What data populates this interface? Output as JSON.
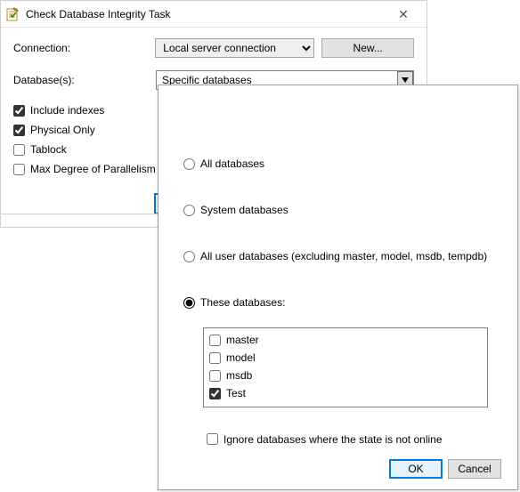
{
  "window": {
    "title": "Check Database Integrity Task"
  },
  "connection": {
    "label": "Connection:",
    "selected": "Local server connection",
    "new_button": "New..."
  },
  "databases": {
    "label": "Database(s):",
    "selected": "Specific databases"
  },
  "options": {
    "include_indexes": "Include indexes",
    "physical_only": "Physical Only",
    "tablock": "Tablock",
    "max_dop": "Max Degree of Parallelism"
  },
  "buttons": {
    "ok": "OK",
    "cancel": "Cancel"
  },
  "popup": {
    "all_databases": "All databases",
    "system_databases": "System databases",
    "all_user_databases": "All user databases  (excluding master, model, msdb, tempdb)",
    "these_databases": "These databases:",
    "db_list": [
      {
        "name": "master",
        "checked": false
      },
      {
        "name": "model",
        "checked": false
      },
      {
        "name": "msdb",
        "checked": false
      },
      {
        "name": "Test",
        "checked": true
      }
    ],
    "ignore_offline": "Ignore databases where the state is not online",
    "ok": "OK",
    "cancel": "Cancel"
  }
}
